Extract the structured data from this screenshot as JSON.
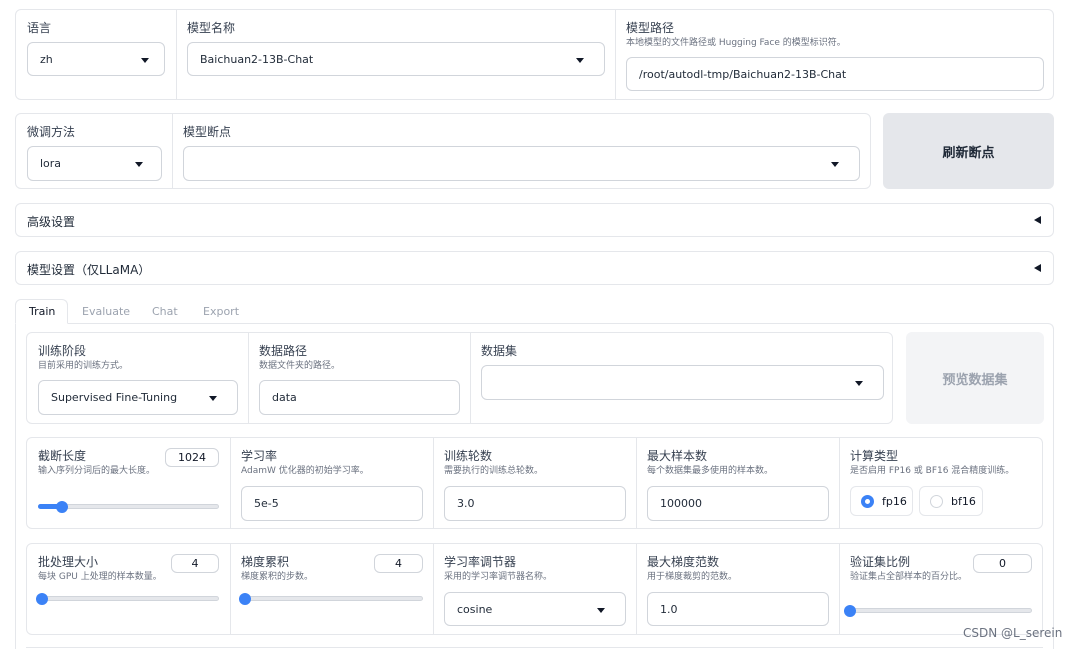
{
  "top": {
    "language": {
      "label": "语言",
      "value": "zh"
    },
    "model_name": {
      "label": "模型名称",
      "value": "Baichuan2-13B-Chat"
    },
    "model_path": {
      "label": "模型路径",
      "info": "本地模型的文件路径或 Hugging Face 的模型标识符。",
      "value": "/root/autodl-tmp/Baichuan2-13B-Chat"
    }
  },
  "finetune": {
    "method": {
      "label": "微调方法",
      "value": "lora"
    },
    "checkpoint": {
      "label": "模型断点",
      "value": ""
    },
    "refresh_button": "刷新断点"
  },
  "accordions": {
    "advanced": "高级设置",
    "llama": "模型设置（仅LLaMA）"
  },
  "tabs": [
    "Train",
    "Evaluate",
    "Chat",
    "Export"
  ],
  "train": {
    "stage": {
      "label": "训练阶段",
      "info": "目前采用的训练方式。",
      "value": "Supervised Fine-Tuning"
    },
    "data_dir": {
      "label": "数据路径",
      "info": "数据文件夹的路径。",
      "value": "data"
    },
    "dataset": {
      "label": "数据集",
      "value": ""
    },
    "preview_button": "预览数据集",
    "cutoff_len": {
      "label": "截断长度",
      "info": "输入序列分词后的最大长度。",
      "value": "1024",
      "fraction": 0.13
    },
    "learning_rate": {
      "label": "学习率",
      "info": "AdamW 优化器的初始学习率。",
      "value": "5e-5"
    },
    "epochs": {
      "label": "训练轮数",
      "info": "需要执行的训练总轮数。",
      "value": "3.0"
    },
    "max_samples": {
      "label": "最大样本数",
      "info": "每个数据集最多使用的样本数。",
      "value": "100000"
    },
    "compute_type": {
      "label": "计算类型",
      "info": "是否启用 FP16 或 BF16 混合精度训练。",
      "options": [
        "fp16",
        "bf16"
      ],
      "selected": "fp16"
    },
    "batch_size": {
      "label": "批处理大小",
      "info": "每块 GPU 上处理的样本数量。",
      "value": "4",
      "fraction": 0.02
    },
    "grad_accum": {
      "label": "梯度累积",
      "info": "梯度累积的步数。",
      "value": "4",
      "fraction": 0.02
    },
    "lr_scheduler": {
      "label": "学习率调节器",
      "info": "采用的学习率调节器名称。",
      "value": "cosine"
    },
    "max_grad_norm": {
      "label": "最大梯度范数",
      "info": "用于梯度裁剪的范数。",
      "value": "1.0"
    },
    "val_size": {
      "label": "验证集比例",
      "info": "验证集占全部样本的百分比。",
      "value": "0",
      "fraction": 0.0
    }
  },
  "watermark": "CSDN @L_serein"
}
